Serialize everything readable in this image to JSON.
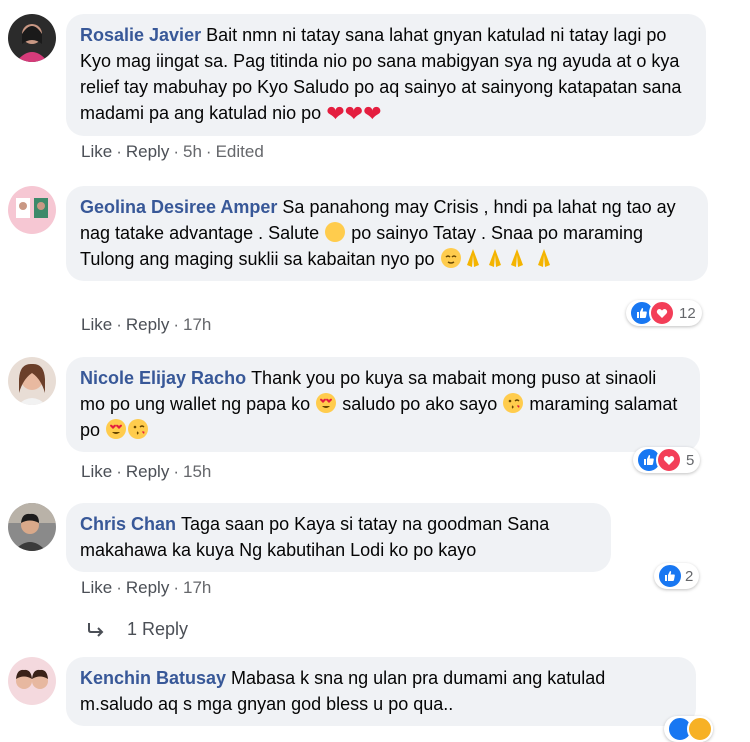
{
  "colors": {
    "author": "#385898",
    "bubble": "#f0f2f5",
    "meta": "#65676b",
    "like": "#1877f2",
    "love": "#f33e58"
  },
  "comments": [
    {
      "author": "Rosalie Javier",
      "text": "Bait nmn ni tatay sana lahat gnyan katulad ni tatay lagi po Kyo mag iingat sa. Pag titinda nio po sana mabigyan sya ng ayuda at o kya relief tay mabuhay po Kyo Saludo po aq sainyo at sainyong katapatan sana madami pa ang katulad nio po",
      "emoji": [
        "red-heart",
        "red-heart",
        "red-heart"
      ],
      "like": "Like",
      "reply": "Reply",
      "time": "5h",
      "edited": "Edited"
    },
    {
      "author": "Geolina Desiree Amper",
      "text_1": "Sa panahong may Crisis , hndi pa lahat ng tao ay nag tatake advantage . Salute",
      "text_2": "po sainyo Tatay . Snaa po maraming Tulong ang maging suklii sa kabaitan nyo po",
      "emoji": [
        "raising-hands",
        "relieved-face",
        "folded-hands",
        "folded-hands",
        "folded-hands",
        "folded-hands"
      ],
      "like": "Like",
      "reply": "Reply",
      "time": "17h",
      "reactions": {
        "icons": [
          "like-icon",
          "love-icon"
        ],
        "count": "12"
      }
    },
    {
      "author": "Nicole Elijay Racho",
      "text_1": "Thank you po kuya sa mabait mong puso at sinaoli mo po ung wallet ng papa ko",
      "text_2": "saludo po ako sayo",
      "text_3": "maraming salamat po",
      "emoji": [
        "heart-eyes-face",
        "kissing-heart-face",
        "heart-eyes-face",
        "kissing-heart-face"
      ],
      "like": "Like",
      "reply": "Reply",
      "time": "15h",
      "reactions": {
        "icons": [
          "like-icon",
          "love-icon"
        ],
        "count": "5"
      }
    },
    {
      "author": "Chris Chan",
      "text": "Taga saan po Kaya si tatay na goodman Sana makahawa ka kuya Ng kabutihan Lodi ko po kayo",
      "like": "Like",
      "reply": "Reply",
      "time": "17h",
      "reactions": {
        "icons": [
          "like-icon"
        ],
        "count": "2"
      },
      "replies_label": "1 Reply"
    },
    {
      "author": "Kenchin Batusay",
      "text": "Mabasa k sna ng ulan pra dumami ang katulad m.saludo aq s mga gnyan god bless u po qua.."
    }
  ]
}
